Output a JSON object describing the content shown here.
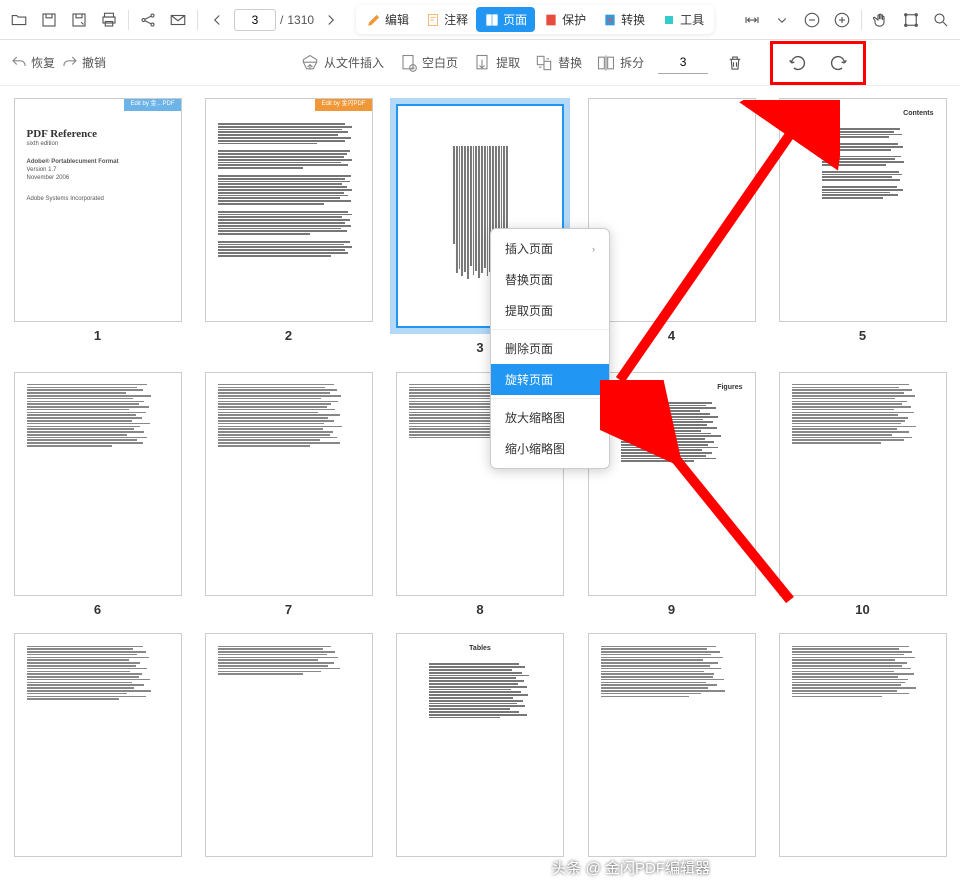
{
  "topbar": {
    "page_current": "3",
    "page_sep": "/",
    "page_total": "1310",
    "tabs": {
      "edit": "编辑",
      "annotate": "注释",
      "page": "页面",
      "protect": "保护",
      "convert": "转换",
      "tools": "工具"
    }
  },
  "secondbar": {
    "undo": "恢复",
    "redo": "撤销",
    "insert_from_file": "从文件插入",
    "blank_page": "空白页",
    "extract": "提取",
    "replace": "替换",
    "split": "拆分",
    "split_num": "3"
  },
  "context_menu": {
    "insert_page": "插入页面",
    "replace_page": "替换页面",
    "extract_page": "提取页面",
    "delete_page": "删除页面",
    "rotate_page": "旋转页面",
    "zoom_in_thumb": "放大缩略图",
    "zoom_out_thumb": "缩小缩略图"
  },
  "thumbs": {
    "badge_blue": "Edit by 金…PDF",
    "badge_orange": "Edit by 金闪PDF",
    "page1": {
      "title": "PDF Reference",
      "subtitle": "sixth edition",
      "line1": "Adobe® Portablecument Format",
      "line2": "Version 1.7",
      "line3": "November 2006",
      "line4": "Adobe Systems Incorporated"
    },
    "page5_title": "Contents",
    "page9_title": "Figures",
    "page13_title": "Tables",
    "labels": [
      "1",
      "2",
      "3",
      "4",
      "5",
      "6",
      "7",
      "8",
      "9",
      "10"
    ]
  },
  "watermark": "头条 @ 金闪PDF编辑器"
}
